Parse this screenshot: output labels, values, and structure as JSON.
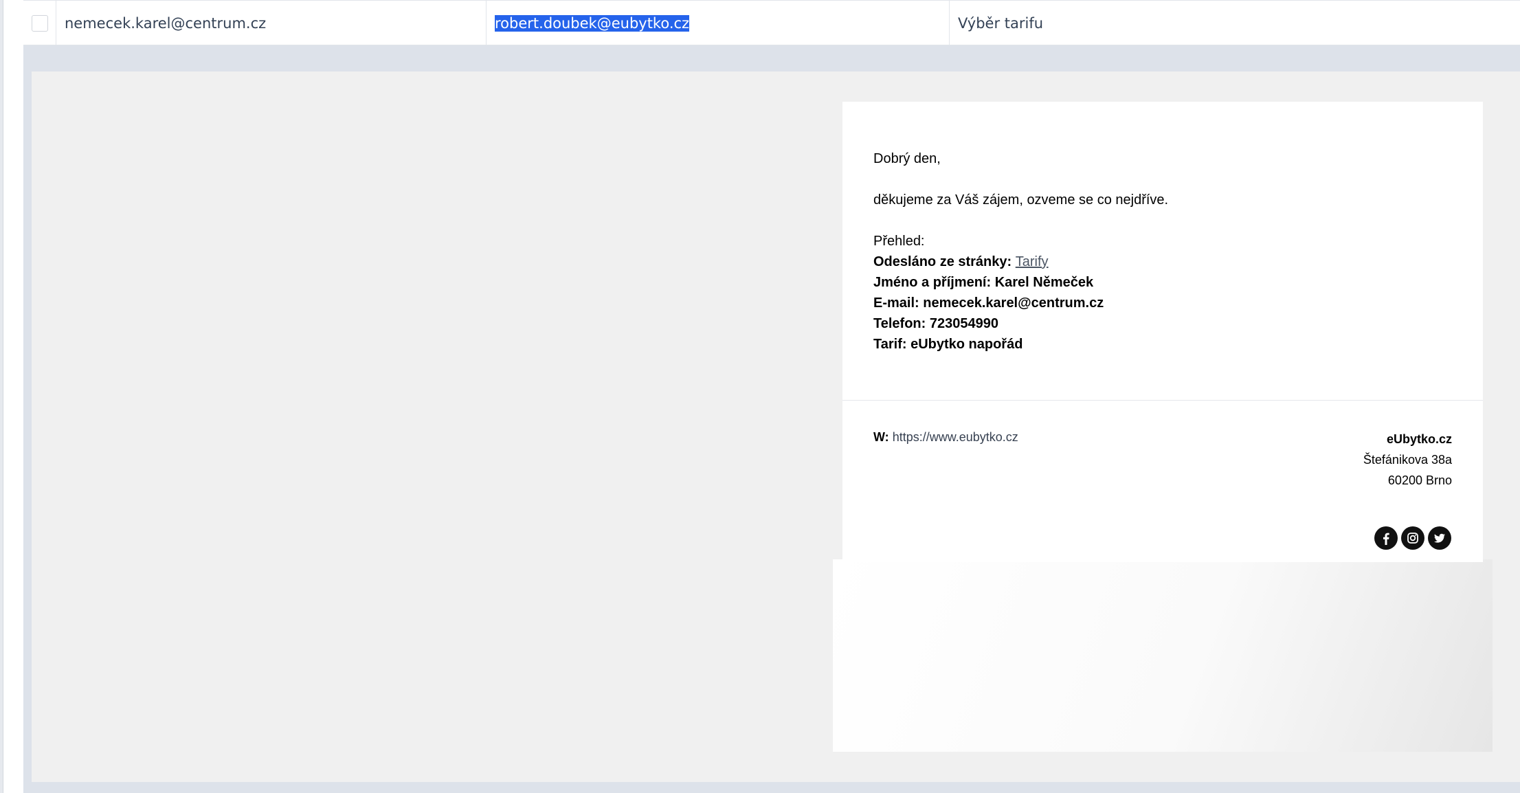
{
  "row": {
    "from": "nemecek.karel@centrum.cz",
    "to": "robert.doubek@eubytko.cz",
    "subject": "Výběr tarifu"
  },
  "email": {
    "greeting": "Dobrý den,",
    "message": "děkujeme za Váš zájem, ozveme se co nejdříve.",
    "overview_label": "Přehled:",
    "fields": {
      "page_label": "Odesláno ze stránky:",
      "page_value": "Tarify",
      "name": "Jméno a příjmení: Karel Němeček",
      "email": "E-mail: nemecek.karel@centrum.cz",
      "phone": "Telefon: 723054990",
      "tariff": "Tarif: eUbytko napořád"
    },
    "footer": {
      "web_label": "W:",
      "web_url": "https://www.eubytko.cz",
      "company": "eUbytko.cz",
      "street": "Štefánikova 38a",
      "city": "60200 Brno",
      "social_icons": [
        "facebook-icon",
        "instagram-icon",
        "twitter-icon"
      ]
    }
  },
  "colors": {
    "selection": "#2563eb",
    "preview_frame": "#dde2ea",
    "preview_bg": "#f0f0f0"
  }
}
